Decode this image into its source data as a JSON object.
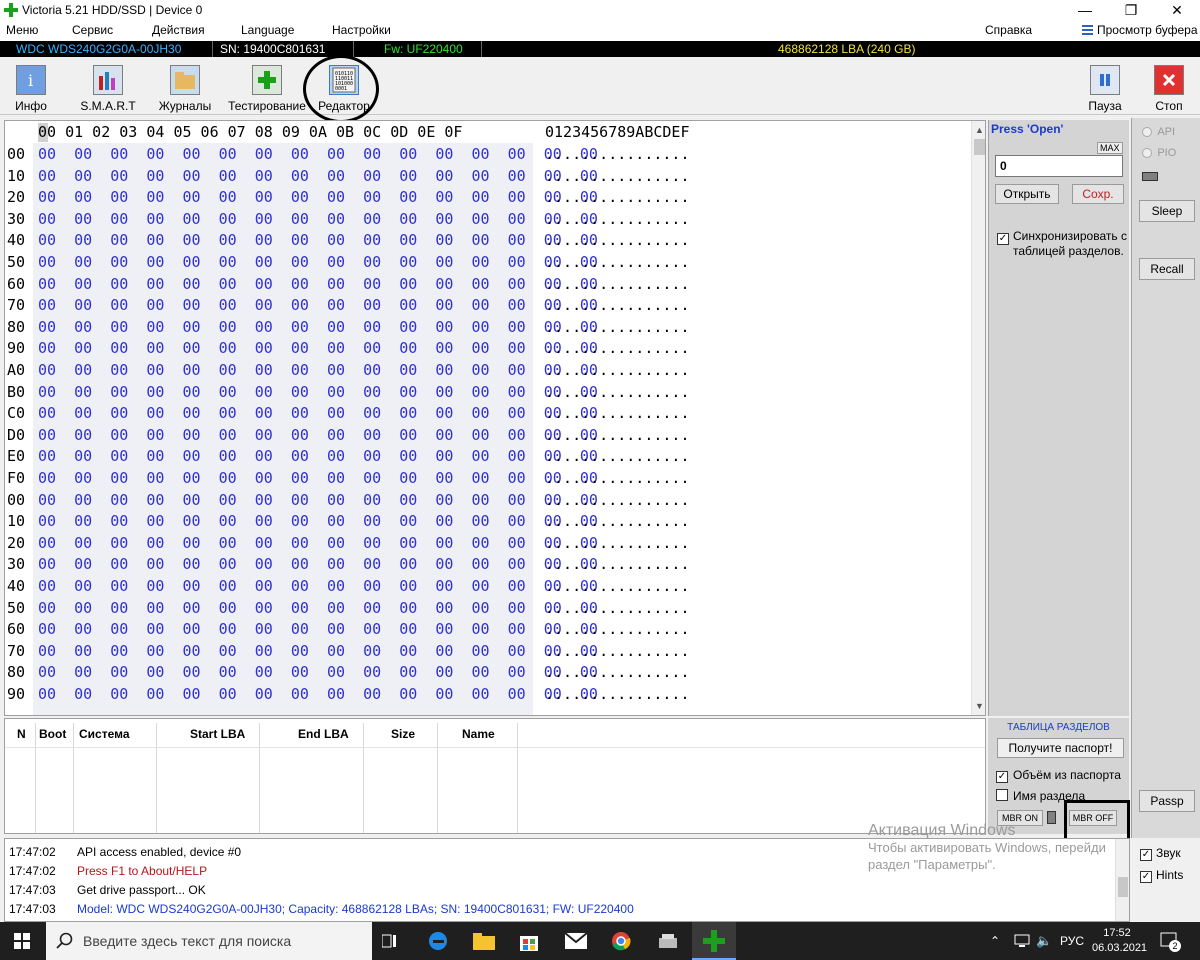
{
  "window": {
    "title": "Victoria 5.21 HDD/SSD | Device 0",
    "controls": [
      "—",
      "❐",
      "✕"
    ]
  },
  "menu": {
    "items": [
      "Меню",
      "Сервис",
      "Действия",
      "Language",
      "Настройки"
    ],
    "help": "Справка",
    "clipboard": "Просмотр буфера"
  },
  "device": {
    "model": "WDC WDS240G2G0A-00JH30",
    "sn": "SN: 19400C801631",
    "fw": "Fw: UF220400",
    "lba": "468862128 LBA (240 GB)",
    "colors": {
      "model": "#3cb0ff",
      "sn": "#ffffff",
      "fw": "#30e030",
      "lba": "#f2e23a"
    }
  },
  "toolbar": {
    "buttons": [
      {
        "label": "Инфо",
        "icon": "info-icon"
      },
      {
        "label": "S.M.A.R.T",
        "icon": "chart-icon"
      },
      {
        "label": "Журналы",
        "icon": "folder-icon"
      },
      {
        "label": "Тестирование",
        "icon": "plus-icon"
      },
      {
        "label": "Редактор",
        "icon": "binary-editor-icon",
        "glyph": "010110\n110011\n101000\n0001"
      }
    ],
    "pause": "Пауза",
    "stop": "Стоп"
  },
  "hex": {
    "header": "00 01 02 03 04 05 06 07 08 09 0A 0B 0C 0D 0E 0F",
    "ascii_header": "0123456789ABCDEF",
    "rows": [
      "00",
      "10",
      "20",
      "30",
      "40",
      "50",
      "60",
      "70",
      "80",
      "90",
      "A0",
      "B0",
      "C0",
      "D0",
      "E0",
      "F0",
      "00",
      "10",
      "20",
      "30",
      "40",
      "50",
      "60",
      "70",
      "80",
      "90"
    ],
    "bytes": "00  00  00  00  00  00  00  00  00  00  00  00  00  00  00  00",
    "ascii": "................"
  },
  "right_panel": {
    "press_open": "Press 'Open'",
    "max": "MAX",
    "input_value": "0",
    "open_button": "Открыть",
    "save_button": "Сохр.",
    "sync_label": "Синхронизировать с таблицей разделов.",
    "partition_title": "ТАБЛИЦА РАЗДЕЛОВ",
    "passport_button": "Получите паспорт!",
    "volume_from_passport": "Объём из паспорта",
    "partition_name": "Имя раздела",
    "mbr_on": "MBR ON",
    "mbr_off": "MBR OFF"
  },
  "far_right": {
    "api": "API",
    "pio": "PIO",
    "sleep": "Sleep",
    "recall": "Recall",
    "passp": "Passp",
    "sound": "Звук",
    "hints": "Hints"
  },
  "partition_table": {
    "columns": [
      "N",
      "Boot",
      "Система",
      "Start LBA",
      "End LBA",
      "Size",
      "Name"
    ]
  },
  "log": [
    {
      "time": "17:47:02",
      "msg": "API access enabled, device #0",
      "color": "#000000"
    },
    {
      "time": "17:47:02",
      "msg": "Press F1 to About/HELP",
      "color": "#b01818"
    },
    {
      "time": "17:47:03",
      "msg": "Get drive passport... OK",
      "color": "#000000"
    },
    {
      "time": "17:47:03",
      "msg": "Model: WDC WDS240G2G0A-00JH30; Capacity: 468862128 LBAs; SN: 19400C801631; FW: UF220400",
      "color": "#1a3ad0"
    }
  ],
  "watermark": {
    "line1": "Активация Windows",
    "line2": "Чтобы активировать Windows, перейди",
    "line3": "раздел \"Параметры\"."
  },
  "taskbar": {
    "search_placeholder": "Введите здесь текст для поиска",
    "lang": "РУС",
    "time": "17:52",
    "date": "06.03.2021",
    "notifications": "2"
  }
}
